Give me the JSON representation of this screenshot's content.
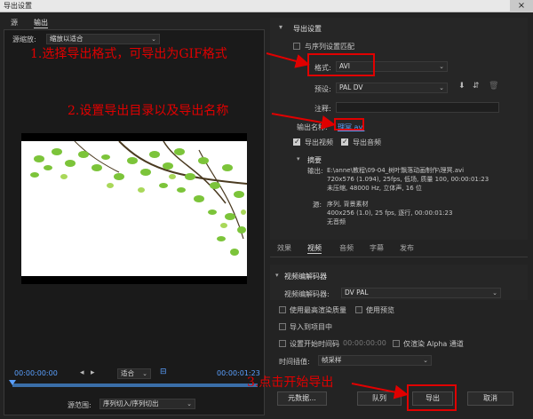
{
  "window": {
    "title": "导出设置",
    "close": "×"
  },
  "left": {
    "tabs": [
      "源",
      "输出"
    ],
    "source_scale_label": "源缩放:",
    "source_scale_value": "缩放以适合",
    "timecode_start": "00:00:00:00",
    "timecode_end": "00:00:01:23",
    "fit_value": "适合",
    "source_range_label": "源范围:",
    "source_range_value": "序列切入/序列切出"
  },
  "export_settings": {
    "header": "导出设置",
    "match_sequence": "与序列设置匹配",
    "format_label": "格式:",
    "format_value": "AVI",
    "preset_label": "预设:",
    "preset_value": "PAL DV",
    "comment_label": "注释:",
    "output_name_label": "输出名称:",
    "output_name_value": "理冥.avi",
    "export_video": "导出视频",
    "export_audio": "导出音频",
    "summary_header": "摘要",
    "output_label": "输出:",
    "output_lines": [
      "E:\\anne\\教程\\09-04_树叶飘落动画制作\\理冥.avi",
      "720x576 (1.094), 25fps, 低场, 质量 100, 00:00:01:23",
      "未压缩, 48000 Hz, 立体声, 16 位"
    ],
    "source_label": "源:",
    "source_lines": [
      "序列, 背景素材",
      "400x256 (1.0), 25 fps, 逐行, 00:00:01:23",
      "无音频"
    ]
  },
  "subtabs": [
    "效果",
    "视频",
    "音频",
    "字幕",
    "发布"
  ],
  "video_codec": {
    "header": "视频编解码器",
    "codec_label": "视频编解码器:",
    "codec_value": "DV PAL"
  },
  "bottom": {
    "use_max_render": "使用最高渲染质量",
    "use_previews": "使用预览",
    "import_into_project": "导入到项目中",
    "set_start_timecode": "设置开始时间码",
    "start_timecode_value": "00:00:00:00",
    "render_alpha_only": "仅渲染 Alpha 通道",
    "time_interpolation_label": "时间插值:",
    "time_interpolation_value": "帧采样",
    "metadata_button": "元数据...",
    "queue_button": "队列",
    "export_button": "导出",
    "cancel_button": "取消"
  },
  "annotations": {
    "step1": "1.选择导出格式，可导出为GIF格式",
    "step2": "2.设置导出目录以及导出名称",
    "step3": "3.点击开始导出"
  },
  "colors": {
    "annotation": "#e00000",
    "timecode": "#5aa0ff",
    "leaf": "#7cc43a"
  }
}
